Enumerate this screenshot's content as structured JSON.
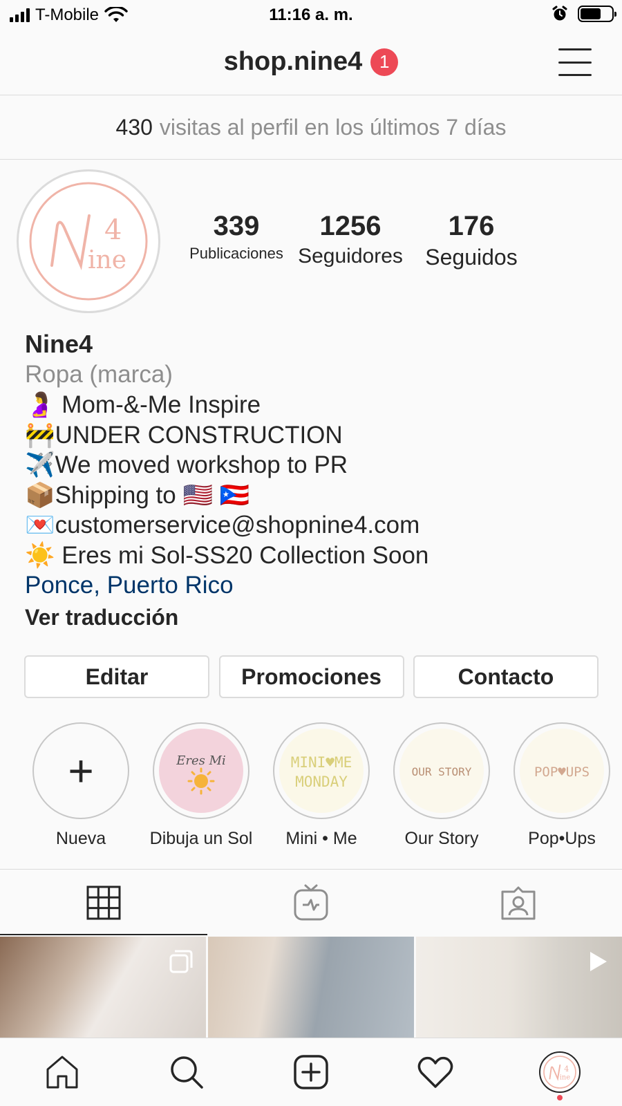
{
  "status_bar": {
    "carrier": "T-Mobile",
    "time": "11:16 a. m.",
    "battery_level": 0.65
  },
  "header": {
    "username": "shop.nine4",
    "notification_count": "1"
  },
  "visits": {
    "count": "430",
    "text": "visitas al perfil en los últimos 7 días"
  },
  "profile": {
    "logo_text": "Nine 4",
    "stats": [
      {
        "value": "339",
        "label": "Publicaciones"
      },
      {
        "value": "1256",
        "label": "Seguidores"
      },
      {
        "value": "176",
        "label": "Seguidos"
      }
    ],
    "name": "Nine4",
    "category": "Ropa (marca)",
    "bio_lines": [
      "🤰 Mom-&-Me Inspire",
      "🚧UNDER CONSTRUCTION",
      "✈️We moved workshop to PR",
      "📦Shipping to 🇺🇸 🇵🇷",
      "💌customerservice@shopnine4.com",
      "☀️ Eres mi Sol-SS20 Collection Soon"
    ],
    "location": "Ponce, Puerto Rico",
    "translate": "Ver traducción"
  },
  "buttons": {
    "edit": "Editar",
    "promotions": "Promociones",
    "contact": "Contacto"
  },
  "highlights": [
    {
      "label": "Nueva",
      "cover_text": "+"
    },
    {
      "label": "Dibuja un Sol",
      "cover_text": "Eres Mi"
    },
    {
      "label": "Mini • Me",
      "cover_text": "MINI♥ME MONDAY"
    },
    {
      "label": "Our Story",
      "cover_text": "OUR STORY"
    },
    {
      "label": "Pop•Ups",
      "cover_text": "POP♥UPS"
    }
  ],
  "colors": {
    "accent_link": "#003569",
    "badge": "#ed4956",
    "logo_pink": "#f0b4a8"
  },
  "icons": {
    "tabs": [
      "grid-icon",
      "igtv-icon",
      "tagged-icon"
    ],
    "nav": [
      "home-icon",
      "search-icon",
      "add-post-icon",
      "heart-icon",
      "profile-avatar"
    ],
    "grid_overlays": [
      "multi-photo-icon",
      "",
      "video-play-icon"
    ]
  }
}
